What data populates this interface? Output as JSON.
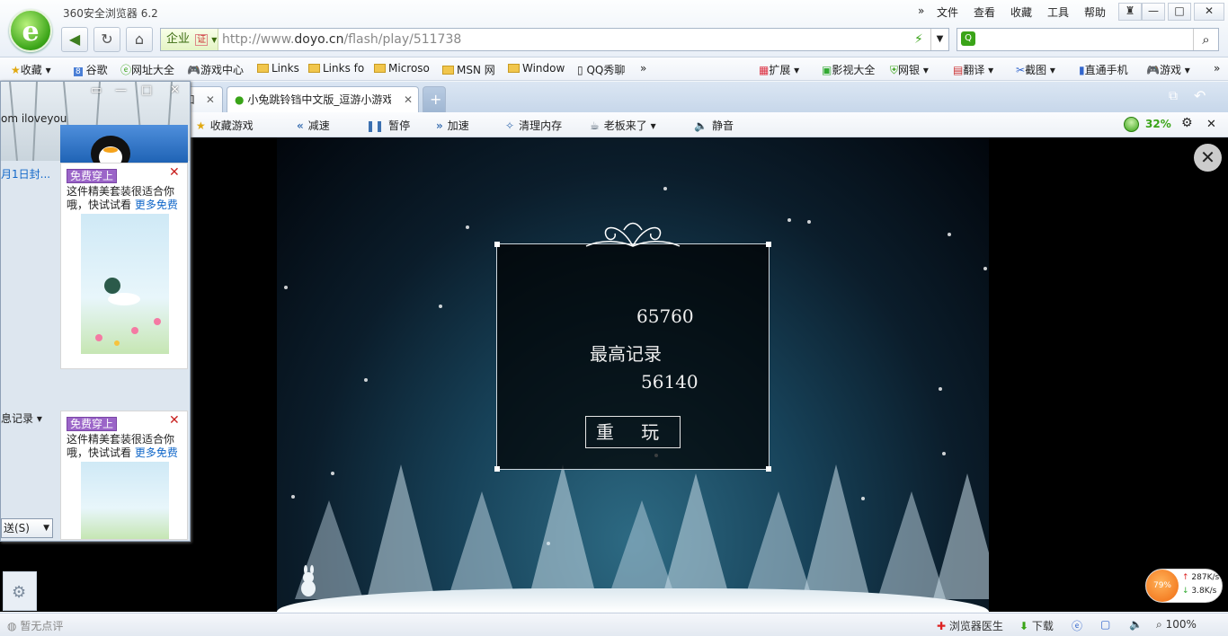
{
  "app": {
    "title": "360安全浏览器 6.2"
  },
  "menu": [
    "文件",
    "查看",
    "收藏",
    "工具",
    "帮助"
  ],
  "window_controls": [
    "衣",
    "—",
    "□",
    "✕"
  ],
  "address": {
    "enterprise_label": "企业",
    "cert_label": "证",
    "url_prefix": "http://www.",
    "url_domain": "doyo.cn",
    "url_path": "/flash/play/511738"
  },
  "bookmarks": [
    {
      "label": "收藏",
      "icon": "star-icon"
    },
    {
      "label": "谷歌",
      "icon": "google-icon"
    },
    {
      "label": "网址大全",
      "icon": "e-icon"
    },
    {
      "label": "游戏中心",
      "icon": "gamepad-icon"
    },
    {
      "label": "Links",
      "icon": "folder-icon"
    },
    {
      "label": "Links fo",
      "icon": "folder-icon"
    },
    {
      "label": "Microso",
      "icon": "folder-icon"
    },
    {
      "label": "MSN 网",
      "icon": "folder-icon"
    },
    {
      "label": "Window",
      "icon": "folder-icon"
    },
    {
      "label": "QQ秀聊",
      "icon": "page-icon"
    }
  ],
  "bookmarks_right": [
    "扩展",
    "影视大全",
    "网银",
    "翻译",
    "截图",
    "直通手机",
    "游戏"
  ],
  "tabs": [
    {
      "label": "口",
      "active": false
    },
    {
      "label": "小兔跳铃铛中文版_逗游小游戏",
      "active": true
    }
  ],
  "new_tab": "+",
  "toolbar": {
    "favorite": "收藏游戏",
    "slow": "减速",
    "pause": "暂停",
    "speed": "加速",
    "clean": "清理内存",
    "boss": "老板来了",
    "mute": "静音",
    "percent": "32%"
  },
  "game": {
    "score": "65760",
    "record_label": "最高记录",
    "best": "56140",
    "replay": "重 玩"
  },
  "qq_panel": {
    "user_text": "om  iloveyou",
    "date_text": "月1日封...",
    "msg_record": "息记录",
    "send": "送(S)",
    "ads": [
      {
        "badge": "免费穿上",
        "line1": "这件精美套装很适合你",
        "line2": "哦，快试试看",
        "more": "更多免费"
      },
      {
        "badge": "免费穿上",
        "line1": "这件精美套装很适合你",
        "line2": "哦，快试试看",
        "more": "更多免费"
      }
    ]
  },
  "status": {
    "rating": "暂无点评",
    "doctor": "浏览器医生",
    "download": "下载",
    "zoom": "100%"
  },
  "network": {
    "percent": "79%",
    "up": "287K/s",
    "down": "3.8K/s"
  }
}
